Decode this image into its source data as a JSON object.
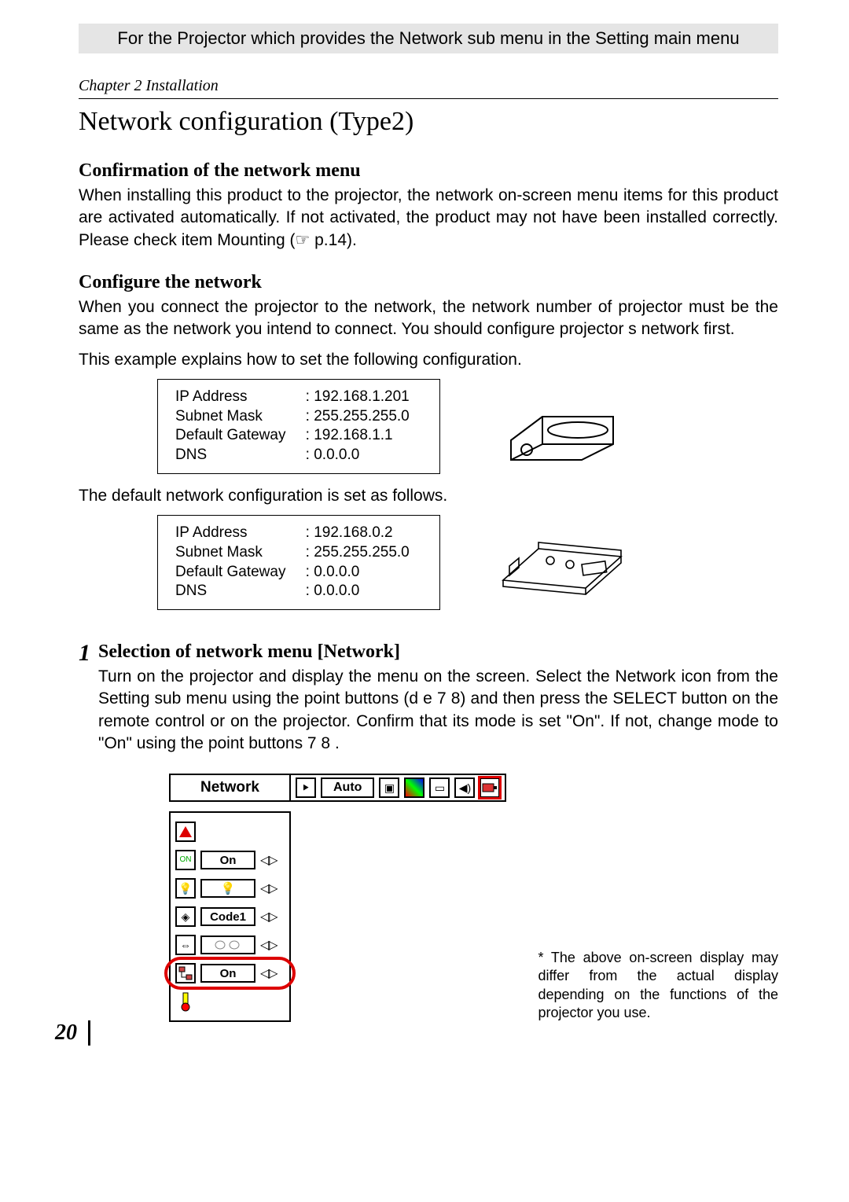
{
  "banner": "For the Projector which provides the Network sub menu in the Setting main menu",
  "chapter": "Chapter 2 Installation",
  "title": "Network configuration (Type2)",
  "sec1_heading": "Confirmation of the network menu",
  "sec1_body": "When installing this product to the projector, the network on-screen menu items for this product are activated automatically. If not activated, the product may not have been installed correctly. Please check item Mounting (☞ p.14).",
  "sec2_heading": "Configure the network",
  "sec2_body1": "When you connect the projector to the network, the network number of projector must be the same as the network you intend to connect. You should configure projector s network first.",
  "sec2_body2": "This example explains how to set the following configuration.",
  "cfg1": {
    "ip_label": "IP Address",
    "ip_val": ": 192.168.1.201",
    "mask_label": "Subnet Mask",
    "mask_val": ": 255.255.255.0",
    "gw_label": "Default Gateway",
    "gw_val": ": 192.168.1.1",
    "dns_label": "DNS",
    "dns_val": ": 0.0.0.0"
  },
  "sec2_body3": "The default network configuration is set as follows.",
  "cfg2": {
    "ip_label": "IP Address",
    "ip_val": ": 192.168.0.2",
    "mask_label": "Subnet Mask",
    "mask_val": ": 255.255.255.0",
    "gw_label": "Default Gateway",
    "gw_val": ": 0.0.0.0",
    "dns_label": "DNS",
    "dns_val": ": 0.0.0.0"
  },
  "step1_num": "1",
  "step1_heading": "Selection of network menu [Network]",
  "step1_body": "Turn on the projector and display the menu on the screen. Select the Network icon from the Setting sub menu using the point buttons (d e 7 8) and then press the SELECT button on the remote control or on the projector. Confirm that its mode is set \"On\". If not, change mode to \"On\" using the point buttons 7 8 .",
  "osd": {
    "tab_label": "Network",
    "auto_label": "Auto",
    "rows": {
      "r2_val": "On",
      "r4_val": "Code1",
      "r6_val": "On"
    }
  },
  "footnote_prefix": "* ",
  "footnote": "The above on-screen display may differ from the actual display depending on the functions of the projector you use.",
  "page_number": "20"
}
